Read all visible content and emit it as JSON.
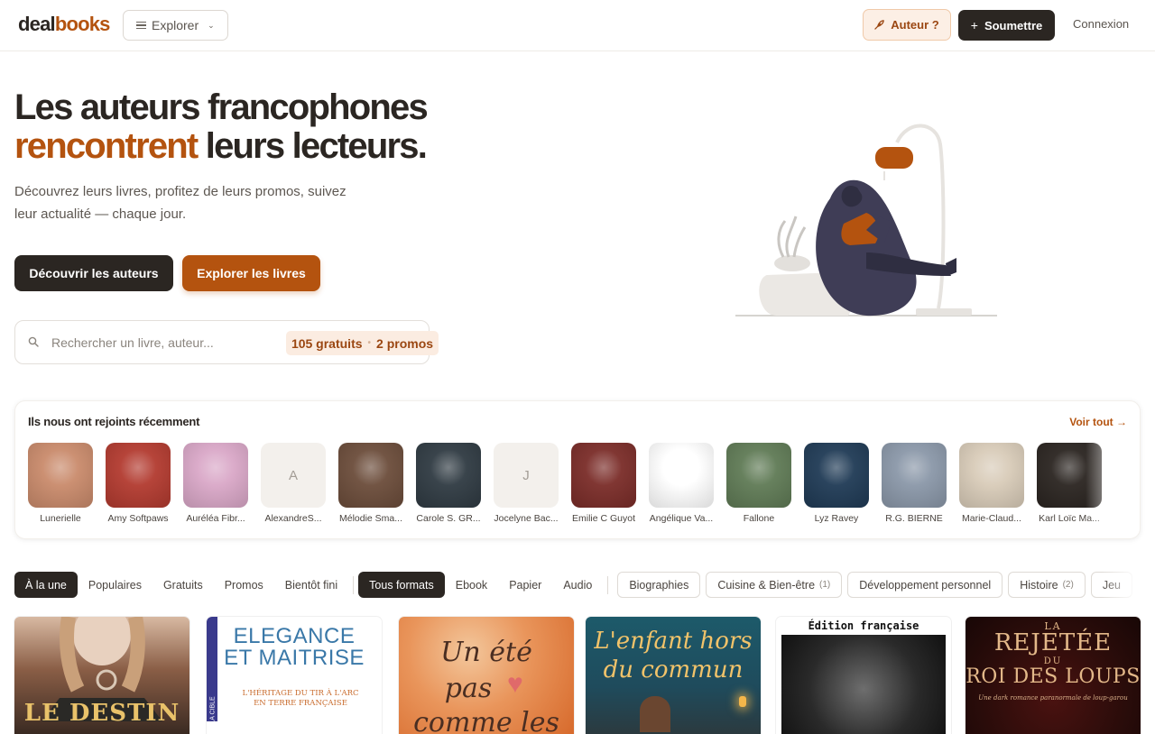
{
  "header": {
    "logo_part1": "deal",
    "logo_part2": "books",
    "explore_label": "Explorer",
    "author_label": "Auteur ?",
    "submit_label": "Soumettre",
    "login_label": "Connexion"
  },
  "hero": {
    "title_line1": "Les auteurs francophones",
    "title_accent": "rencontrent",
    "title_line2_rest": " leurs lecteurs.",
    "subtitle": "Découvrez leurs livres, profitez de leurs promos, suivez leur actualité — chaque jour.",
    "cta_authors": "Découvrir les auteurs",
    "cta_books": "Explorer les livres",
    "search_placeholder": "Rechercher un livre, auteur...",
    "free_count": "105 gratuits",
    "promo_count": "2 promos"
  },
  "authors": {
    "title": "Ils nous ont rejoints récemment",
    "see_all": "Voir tout →",
    "items": [
      {
        "name": "Lunerielle",
        "initial": "",
        "bg": "#c98a6b"
      },
      {
        "name": "Amy Softpaws",
        "initial": "",
        "bg": "#b23a2f"
      },
      {
        "name": "Auréléa Fibr...",
        "initial": "",
        "bg": "#d9a7c7"
      },
      {
        "name": "AlexandreS...",
        "initial": "A",
        "bg": "#f3f0ec"
      },
      {
        "name": "Mélodie Sma...",
        "initial": "",
        "bg": "#6b4c3a"
      },
      {
        "name": "Carole S. GR...",
        "initial": "",
        "bg": "#2f3a42"
      },
      {
        "name": "Jocelyne Bac...",
        "initial": "J",
        "bg": "#f3f0ec"
      },
      {
        "name": "Emilie C Guyot",
        "initial": "",
        "bg": "#7a2c28"
      },
      {
        "name": "Angélique Va...",
        "initial": "",
        "bg": "#ffffff"
      },
      {
        "name": "Fallone",
        "initial": "",
        "bg": "#5f7a55"
      },
      {
        "name": "Lyz Ravey",
        "initial": "",
        "bg": "#1f3a55"
      },
      {
        "name": "R.G. BIERNE",
        "initial": "",
        "bg": "#8a97a8"
      },
      {
        "name": "Marie-Claud...",
        "initial": "",
        "bg": "#d8cbb8"
      },
      {
        "name": "Karl Loïc Ma...",
        "initial": "",
        "bg": "#2a2420"
      }
    ]
  },
  "filters": {
    "sort": [
      "À la une",
      "Populaires",
      "Gratuits",
      "Promos",
      "Bientôt fini"
    ],
    "formats": [
      "Tous formats",
      "Ebook",
      "Papier",
      "Audio"
    ],
    "genres": [
      {
        "label": "Biographies",
        "count": ""
      },
      {
        "label": "Cuisine & Bien-être",
        "count": "(1)"
      },
      {
        "label": "Développement personnel",
        "count": ""
      },
      {
        "label": "Histoire",
        "count": "(2)"
      },
      {
        "label": "Jeu",
        "count": ""
      }
    ]
  },
  "books": [
    {
      "title": "LE DESTIN",
      "bg": "#3a2a22"
    },
    {
      "title_line1": "ELEGANCE",
      "title_line2": "ET MAITRISE",
      "subtitle": "L'HÉRITAGE DU TIR À L'ARC EN TERRE FRANÇAISE",
      "spine": "LA CIBLE"
    },
    {
      "title_line1": "Un été",
      "title_line2": "pas",
      "title_line3": "comme les"
    },
    {
      "title_line1": "L'enfant hors",
      "title_line2": "du commun"
    },
    {
      "banner": "Édition française"
    },
    {
      "title_top": "LA",
      "title_line1": "REJETÉE",
      "title_mid": "DU",
      "title_line2": "ROI DES LOUPS",
      "subtitle": "Une dark romance paranormale de loup-garou"
    }
  ],
  "colors": {
    "accent": "#b4530f",
    "dark": "#2b2622"
  }
}
